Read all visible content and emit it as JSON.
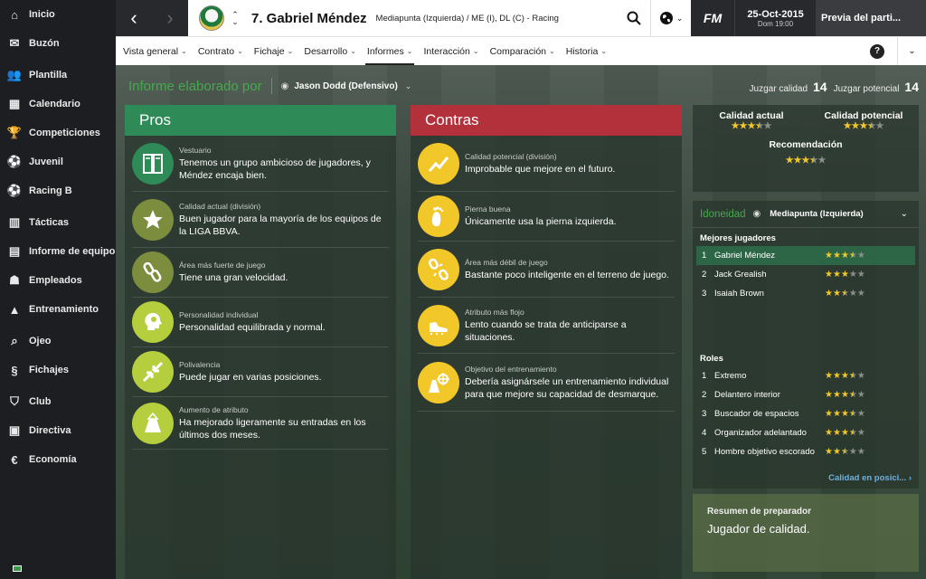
{
  "sidebar": {
    "items": [
      {
        "label": "Inicio",
        "icon": "home-icon"
      },
      {
        "label": "Buzón",
        "icon": "inbox-icon"
      },
      {
        "label": "Plantilla",
        "icon": "squad-icon"
      },
      {
        "label": "Calendario",
        "icon": "calendar-icon"
      },
      {
        "label": "Competiciones",
        "icon": "trophy-icon"
      },
      {
        "label": "Juvenil",
        "icon": "youth-icon"
      },
      {
        "label": "Racing B",
        "icon": "reserve-icon"
      },
      {
        "label": "Tácticas",
        "icon": "tactics-icon"
      },
      {
        "label": "Informe de equipo",
        "icon": "team-report-icon"
      },
      {
        "label": "Empleados",
        "icon": "staff-icon"
      },
      {
        "label": "Entrenamiento",
        "icon": "training-icon"
      },
      {
        "label": "Ojeo",
        "icon": "search-icon"
      },
      {
        "label": "Fichajes",
        "icon": "transfers-icon"
      },
      {
        "label": "Club",
        "icon": "club-icon"
      },
      {
        "label": "Directiva",
        "icon": "board-icon"
      },
      {
        "label": "Economía",
        "icon": "finance-icon"
      }
    ]
  },
  "header": {
    "player_name": "7. Gabriel Méndez",
    "player_info": "Mediapunta (Izquierda) / ME (I), DL (C) - Racing",
    "logo_text": "FM",
    "date": "25-Oct-2015",
    "date_sub": "Dom 19:00",
    "next_button": "Previa del parti..."
  },
  "tabs": [
    {
      "label": "Vista general",
      "active": false
    },
    {
      "label": "Contrato",
      "active": false
    },
    {
      "label": "Fichaje",
      "active": false
    },
    {
      "label": "Desarrollo",
      "active": false
    },
    {
      "label": "Informes",
      "active": true
    },
    {
      "label": "Interacción",
      "active": false
    },
    {
      "label": "Comparación",
      "active": false
    },
    {
      "label": "Historia",
      "active": false
    }
  ],
  "help_label": "?",
  "report": {
    "label": "Informe elaborado por",
    "scout": "Jason Dodd (Defensivo)",
    "judge_quality_label": "Juzgar calidad",
    "judge_quality_value": "14",
    "judge_potential_label": "Juzgar potencial",
    "judge_potential_value": "14"
  },
  "pros": {
    "title": "Pros",
    "items": [
      {
        "category": "Vestuario",
        "text": "Tenemos un grupo ambicioso de jugadores, y Méndez encaja bien.",
        "icon": "locker-icon"
      },
      {
        "category": "Calidad actual (división)",
        "text": "Buen jugador para la mayoría de los equipos de la LIGA BBVA.",
        "icon": "star-icon"
      },
      {
        "category": "Área más fuerte de juego",
        "text": "Tiene una gran velocidad.",
        "icon": "chain-icon"
      },
      {
        "category": "Personalidad individual",
        "text": "Personalidad equilibrada y normal.",
        "icon": "head-icon"
      },
      {
        "category": "Polivalencia",
        "text": "Puede jugar en varias posiciones.",
        "icon": "arrows-icon"
      },
      {
        "category": "Aumento de atributo",
        "text": "Ha mejorado ligeramente su entradas en los últimos dos meses.",
        "icon": "cone-arrow-icon"
      }
    ]
  },
  "cons": {
    "title": "Contras",
    "items": [
      {
        "category": "Calidad potencial (división)",
        "text": "Improbable que mejore en el futuro.",
        "icon": "trend-icon"
      },
      {
        "category": "Pierna buena",
        "text": "Únicamente usa la pierna izquierda.",
        "icon": "foot-icon"
      },
      {
        "category": "Área más débil de juego",
        "text": "Bastante poco inteligente en el terreno de juego.",
        "icon": "broken-chain-icon"
      },
      {
        "category": "Atributo más flojo",
        "text": "Lento cuando se trata de anticiparse a situaciones.",
        "icon": "boot-icon"
      },
      {
        "category": "Objetivo del entrenamiento",
        "text": "Debería asignársele un entrenamiento individual para que mejore su capacidad de desmarque.",
        "icon": "cone-target-icon"
      }
    ]
  },
  "ratings": {
    "current_label": "Calidad actual",
    "current_stars": 3.5,
    "potential_label": "Calidad potencial",
    "potential_stars": 3.5,
    "recommendation_label": "Recomendación",
    "recommendation_stars": 3.5
  },
  "suitability": {
    "label": "Idoneidad",
    "role": "Mediapunta (Izquierda)",
    "best_players_title": "Mejores jugadores",
    "best_players": [
      {
        "rank": "1",
        "name": "Gabriel Méndez",
        "stars": 3.5,
        "highlight": true
      },
      {
        "rank": "2",
        "name": "Jack Grealish",
        "stars": 3,
        "highlight": false
      },
      {
        "rank": "3",
        "name": "Isaiah Brown",
        "stars": 2.5,
        "highlight": false
      }
    ],
    "roles_title": "Roles",
    "roles": [
      {
        "rank": "1",
        "name": "Extremo",
        "stars": 3.5
      },
      {
        "rank": "2",
        "name": "Delantero interior",
        "stars": 3.5
      },
      {
        "rank": "3",
        "name": "Buscador de espacios",
        "stars": 3.5
      },
      {
        "rank": "4",
        "name": "Organizador adelantado",
        "stars": 3.5
      },
      {
        "rank": "5",
        "name": "Hombre objetivo escorado",
        "stars": 2.5
      }
    ],
    "link": "Calidad en posici..."
  },
  "summary": {
    "title": "Resumen de preparador",
    "text": "Jugador de calidad."
  },
  "colors": {
    "pros_header": "#2e8b57",
    "cons_header": "#b3313b",
    "star_on": "#f2c72a",
    "star_off": "#8a8f8a",
    "accent_green": "#47a84e"
  }
}
